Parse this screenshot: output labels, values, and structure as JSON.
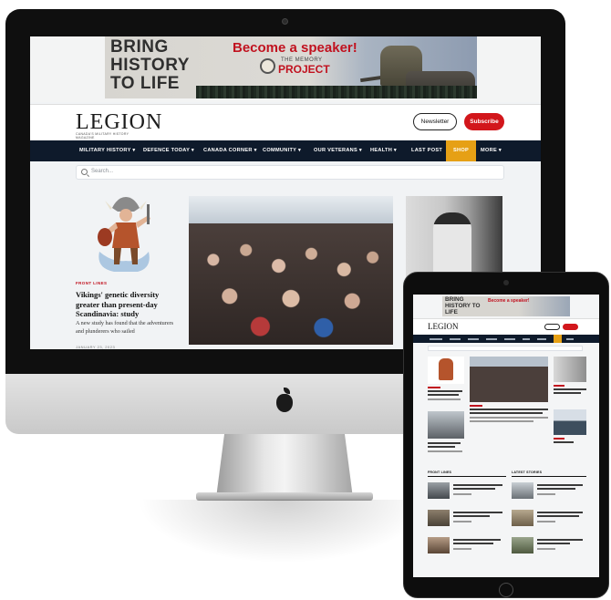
{
  "site": {
    "ad": {
      "headline": "BRING HISTORY TO LIFE",
      "cta": "Become a speaker!",
      "logo_top": "THE MEMORY",
      "logo": "PROJECT"
    },
    "brand": {
      "logo": "LEGION",
      "tagline": "CANADA'S MILITARY HISTORY MAGAZINE"
    },
    "header_buttons": {
      "newsletter": "Newsletter",
      "subscribe": "Subscribe"
    },
    "nav": [
      {
        "label": "MILITARY HISTORY ▾"
      },
      {
        "label": "DEFENCE TODAY ▾"
      },
      {
        "label": "CANADA CORNER ▾"
      },
      {
        "label": "COMMUNITY ▾"
      },
      {
        "label": "OUR VETERANS ▾"
      },
      {
        "label": "HEALTH ▾"
      },
      {
        "label": "LAST POST"
      },
      {
        "label": "SHOP"
      },
      {
        "label": "MORE ▾"
      }
    ],
    "search": {
      "placeholder": "Search..."
    },
    "feature": {
      "kicker": "FRONT LINES",
      "headline": "Vikings' genetic diversity greater than present-day Scandinavia: study",
      "excerpt": "A new study has found that the adventurers and plunderers who sailed",
      "date": "JANUARY 23, 2023"
    }
  },
  "colors": {
    "nav_bg": "#0e1a2b",
    "shop_accent": "#e6a015",
    "subscribe": "#d2161b",
    "kicker": "#c1121f"
  },
  "icons": {
    "search": "search-icon",
    "apple": "apple-logo-icon"
  },
  "tablet": {
    "ad_headline": "BRING HISTORY TO LIFE",
    "ad_cta": "Become a speaker!",
    "logo": "LEGION",
    "front_lines": "FRONT LINES",
    "latest_stories": "LATEST STORIES"
  }
}
